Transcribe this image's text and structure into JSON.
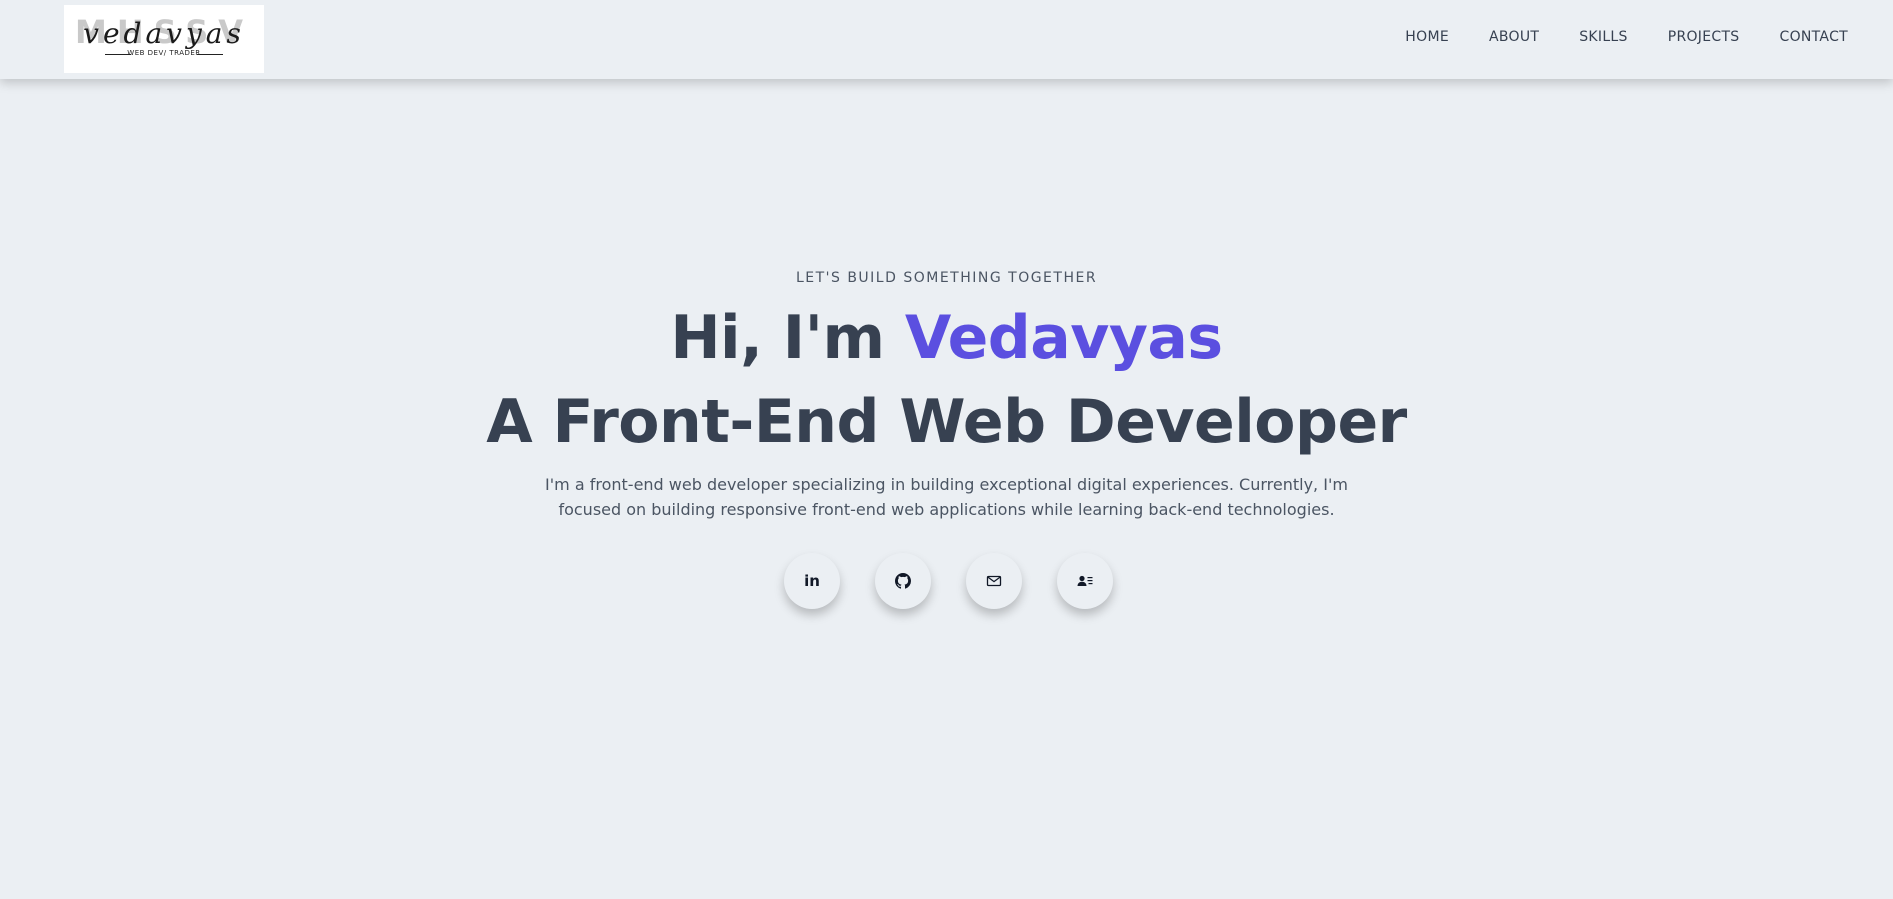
{
  "logo": {
    "background_text": "MHSSV",
    "script_text": "vedavyas",
    "tagline": "WEB DEV/ TRADER"
  },
  "nav": {
    "items": [
      "HOME",
      "ABOUT",
      "SKILLS",
      "PROJECTS",
      "CONTACT"
    ]
  },
  "hero": {
    "eyebrow": "LET'S BUILD SOMETHING TOGETHER",
    "greeting_prefix": "Hi, I'm ",
    "name": "Vedavyas",
    "role": "A Front-End Web Developer",
    "description": "I'm a front-end web developer specializing in building exceptional digital experiences. Currently, I'm focused on building responsive front-end web applications while learning back-end technologies."
  },
  "socials": [
    {
      "icon": "linkedin-icon",
      "text": "in"
    },
    {
      "icon": "github-icon"
    },
    {
      "icon": "mail-icon"
    },
    {
      "icon": "contact-card-icon"
    }
  ],
  "colors": {
    "background": "#ebeff3",
    "text": "#374151",
    "accent": "#5b4fe0"
  }
}
